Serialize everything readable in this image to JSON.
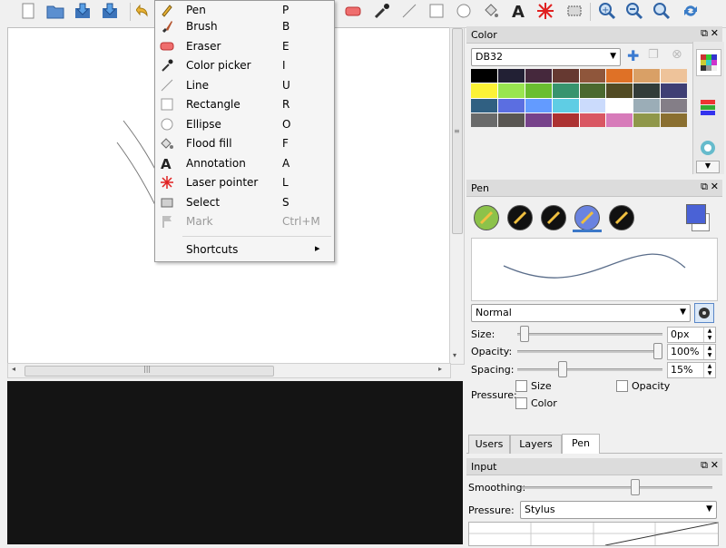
{
  "menu": {
    "items": [
      {
        "label": "Pen",
        "shortcut": "P",
        "icon": "pen-icon"
      },
      {
        "label": "Brush",
        "shortcut": "B",
        "icon": "brush-icon"
      },
      {
        "label": "Eraser",
        "shortcut": "E",
        "icon": "eraser-icon"
      },
      {
        "label": "Color picker",
        "shortcut": "I",
        "icon": "color-picker-icon"
      },
      {
        "label": "Line",
        "shortcut": "U",
        "icon": "line-icon"
      },
      {
        "label": "Rectangle",
        "shortcut": "R",
        "icon": "rectangle-icon"
      },
      {
        "label": "Ellipse",
        "shortcut": "O",
        "icon": "ellipse-icon"
      },
      {
        "label": "Flood fill",
        "shortcut": "F",
        "icon": "flood-fill-icon"
      },
      {
        "label": "Annotation",
        "shortcut": "A",
        "icon": "annotation-icon"
      },
      {
        "label": "Laser pointer",
        "shortcut": "L",
        "icon": "laser-pointer-icon"
      },
      {
        "label": "Select",
        "shortcut": "S",
        "icon": "select-icon"
      },
      {
        "label": "Mark",
        "shortcut": "Ctrl+M",
        "icon": "mark-icon"
      }
    ],
    "shortcuts_label": "Shortcuts",
    "submenu_arrow": "▸"
  },
  "canvas": {
    "hscroll_grip": "|||",
    "vscroll_grip": "≡"
  },
  "color_panel": {
    "title": "Color",
    "palette": "DB32",
    "float_button": "⧉",
    "close_button": "✕",
    "swatches": [
      "#000000",
      "#222034",
      "#45283c",
      "#663931",
      "#8f563b",
      "#df7126",
      "#d9a066",
      "#eec39a",
      "#fbf236",
      "#99e550",
      "#6abe30",
      "#37946e",
      "#4b692f",
      "#524b24",
      "#323c39",
      "#3f3f74",
      "#306082",
      "#5b6ee1",
      "#639bff",
      "#5fcde4",
      "#cbdbfc",
      "#ffffff",
      "#9badb7",
      "#847e87",
      "#696a6a",
      "#595652",
      "#76428a",
      "#ac3232",
      "#d95763",
      "#d77bba",
      "#8f974a",
      "#8a6f30"
    ]
  },
  "pen_panel": {
    "title": "Pen",
    "float_button": "⧉",
    "close_button": "✕",
    "blend_mode": "Normal",
    "size_label": "Size:",
    "size_value": "0px",
    "size_fraction": 0.02,
    "opacity_label": "Opacity:",
    "opacity_value": "100%",
    "opacity_fraction": 1.0,
    "spacing_label": "Spacing:",
    "spacing_value": "15%",
    "spacing_fraction": 0.3,
    "pressure_label": "Pressure:",
    "pressure_size": "Size",
    "pressure_opacity": "Opacity",
    "pressure_color": "Color",
    "foreground_color": "#4a62d6",
    "background_color": "#ffffff"
  },
  "bottom_tabs": {
    "users": "Users",
    "layers": "Layers",
    "pen": "Pen"
  },
  "input_panel": {
    "title": "Input",
    "float_button": "⧉",
    "close_button": "✕",
    "smoothing_label": "Smoothing:",
    "smoothing_fraction": 0.6,
    "pressure_label": "Pressure:",
    "pressure_value": "Stylus"
  },
  "colors": {
    "accent": "#3c78c8",
    "canvas_bg": "#ffffff",
    "view_bg": "#141414"
  }
}
